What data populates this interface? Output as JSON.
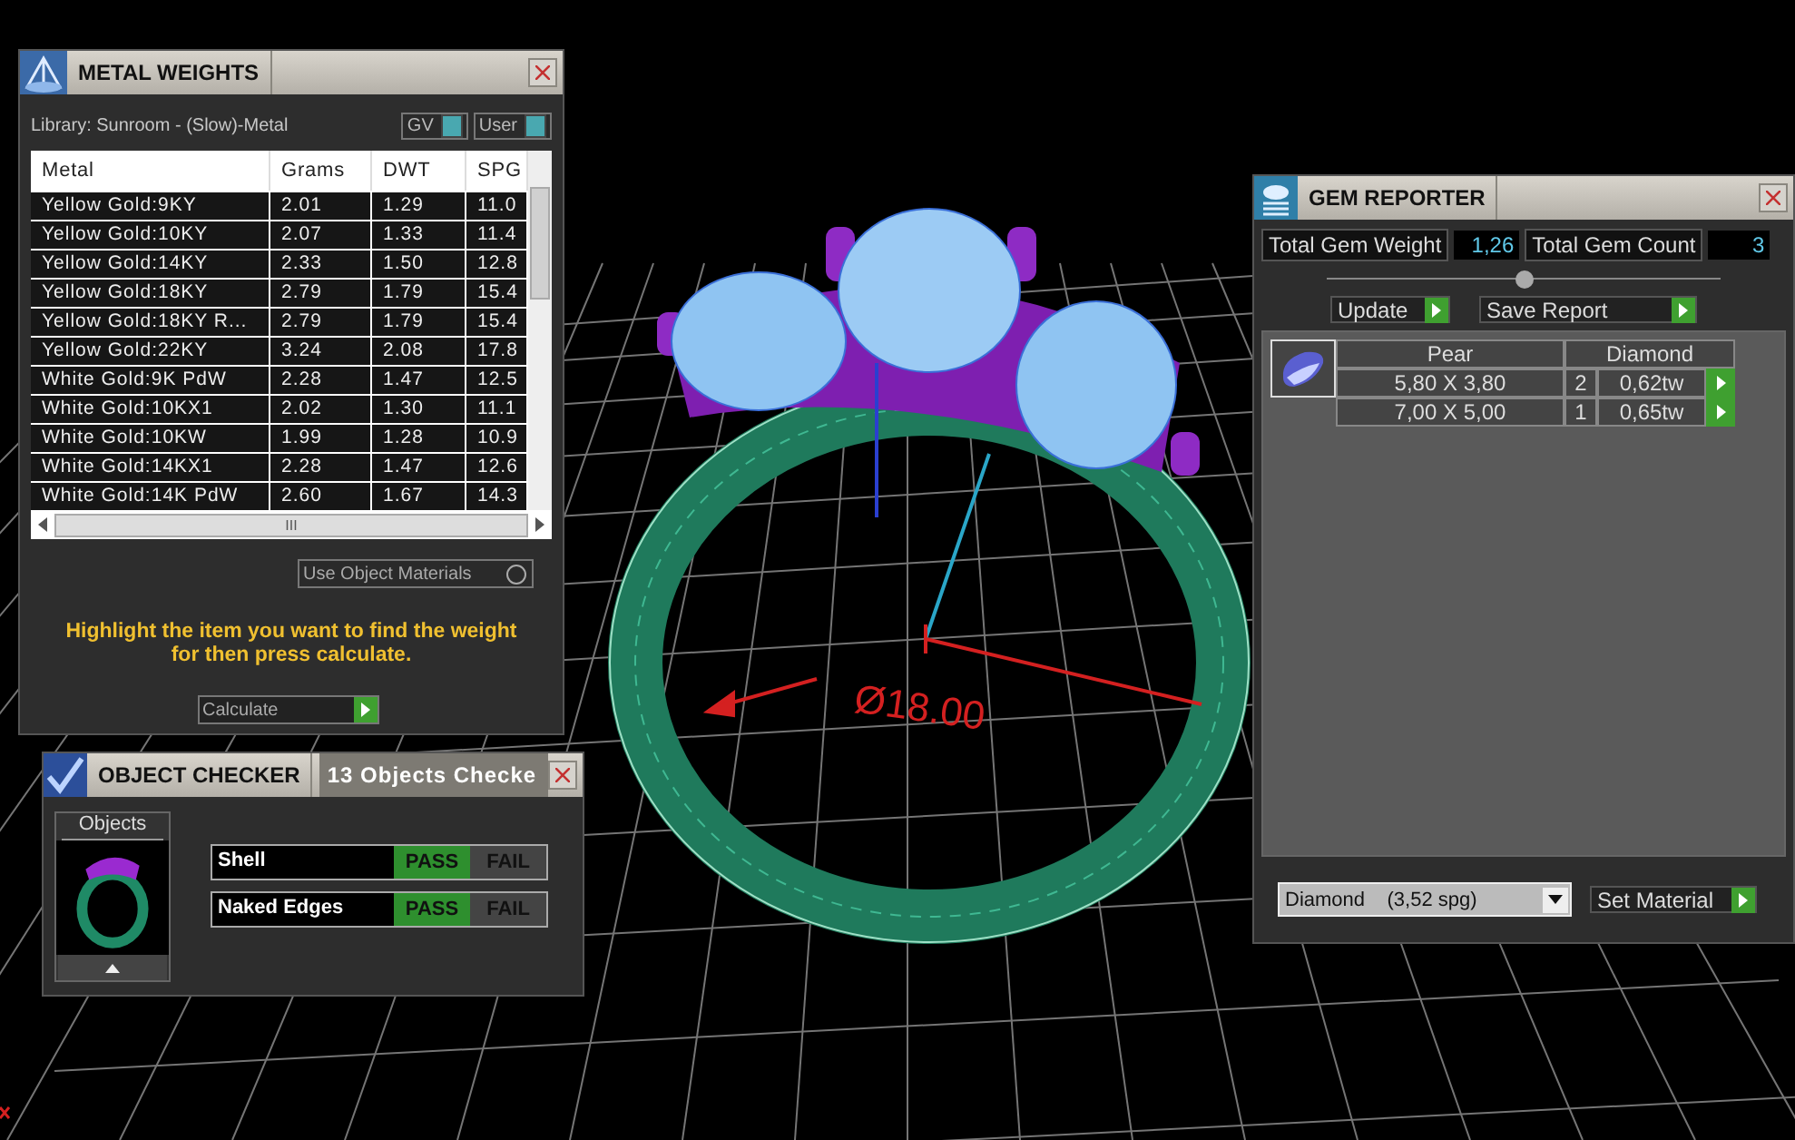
{
  "viewport": {
    "dimension_label": "Ø18.00"
  },
  "metal_weights": {
    "title": "METAL WEIGHTS",
    "library": "Library: Sunroom - (Slow)-Metal",
    "toggles": [
      {
        "label": "GV",
        "on": true
      },
      {
        "label": "User",
        "on": true
      }
    ],
    "columns": [
      "Metal",
      "Grams",
      "DWT",
      "SPG"
    ],
    "rows": [
      {
        "cells": [
          "Yellow Gold:9KY",
          "2.01",
          "1.29",
          "11.0"
        ]
      },
      {
        "cells": [
          "Yellow Gold:10KY",
          "2.07",
          "1.33",
          "11.4"
        ]
      },
      {
        "cells": [
          "Yellow Gold:14KY",
          "2.33",
          "1.50",
          "12.8"
        ]
      },
      {
        "cells": [
          "Yellow Gold:18KY",
          "2.79",
          "1.79",
          "15.4"
        ]
      },
      {
        "cells": [
          "Yellow Gold:18KY R...",
          "2.79",
          "1.79",
          "15.4"
        ]
      },
      {
        "cells": [
          "Yellow Gold:22KY",
          "3.24",
          "2.08",
          "17.8"
        ]
      },
      {
        "cells": [
          "White Gold:9K PdW",
          "2.28",
          "1.47",
          "12.5"
        ]
      },
      {
        "cells": [
          "White Gold:10KX1",
          "2.02",
          "1.30",
          "11.1"
        ]
      },
      {
        "cells": [
          "White Gold:10KW",
          "1.99",
          "1.28",
          "10.9"
        ]
      },
      {
        "cells": [
          "White Gold:14KX1",
          "2.28",
          "1.47",
          "12.6"
        ]
      },
      {
        "cells": [
          "White Gold:14K PdW",
          "2.60",
          "1.67",
          "14.3"
        ]
      }
    ],
    "scroll_grip": "III",
    "use_object_materials": {
      "label": "Use Object Materials",
      "checked": false
    },
    "hint": "Highlight the item you want to find the weight for then press calculate.",
    "calculate": "Calculate"
  },
  "object_checker": {
    "title": "OBJECT CHECKER",
    "status": "13  Objects Checke",
    "objects_label": "Objects",
    "checks": [
      {
        "name": "Shell",
        "passed": true,
        "pass_label": "PASS",
        "fail_label": "FAIL"
      },
      {
        "name": "Naked Edges",
        "passed": true,
        "pass_label": "PASS",
        "fail_label": "FAIL"
      }
    ]
  },
  "gem_reporter": {
    "title": "GEM REPORTER",
    "total_weight": {
      "label": "Total Gem Weight",
      "value": "1,26"
    },
    "total_count": {
      "label": "Total Gem Count",
      "value": "3"
    },
    "buttons": [
      "Update",
      "Save Report"
    ],
    "table": {
      "shape": "Pear",
      "material": "Diamond",
      "rows": [
        {
          "size": "5,80 X 3,80",
          "count": "2",
          "weight": "0,62tw"
        },
        {
          "size": "7,00 X 5,00",
          "count": "1",
          "weight": "0,65tw"
        }
      ]
    },
    "material_select": {
      "value": "Diamond    (3,52 spg)"
    },
    "set_material": "Set Material"
  }
}
